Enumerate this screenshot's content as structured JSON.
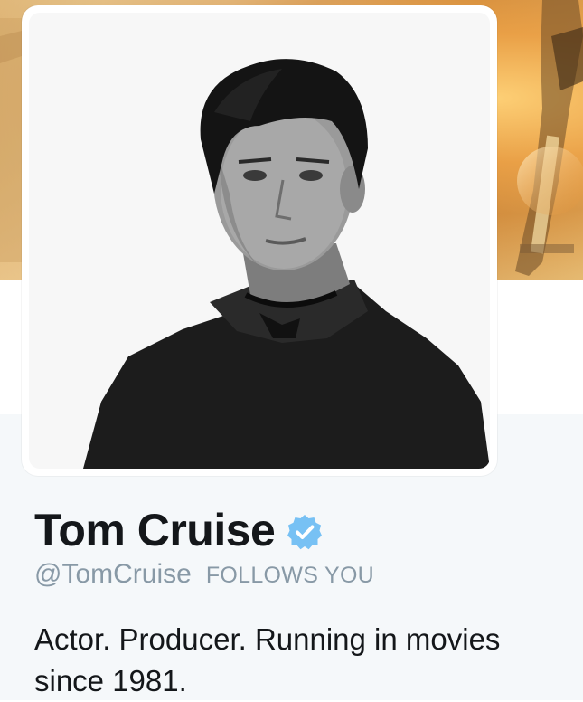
{
  "profile": {
    "name": "Tom Cruise",
    "handle": "@TomCruise",
    "follows_you_label": "FOLLOWS YOU",
    "bio": "Actor. Producer. Running in movies since 1981.",
    "verified": true
  },
  "icons": {
    "verified": "verified-badge-icon"
  },
  "colors": {
    "name_text": "#14171a",
    "secondary_text": "#8899a6",
    "verified_badge": "#77c1f4",
    "page_background": "#f5f8fa"
  }
}
